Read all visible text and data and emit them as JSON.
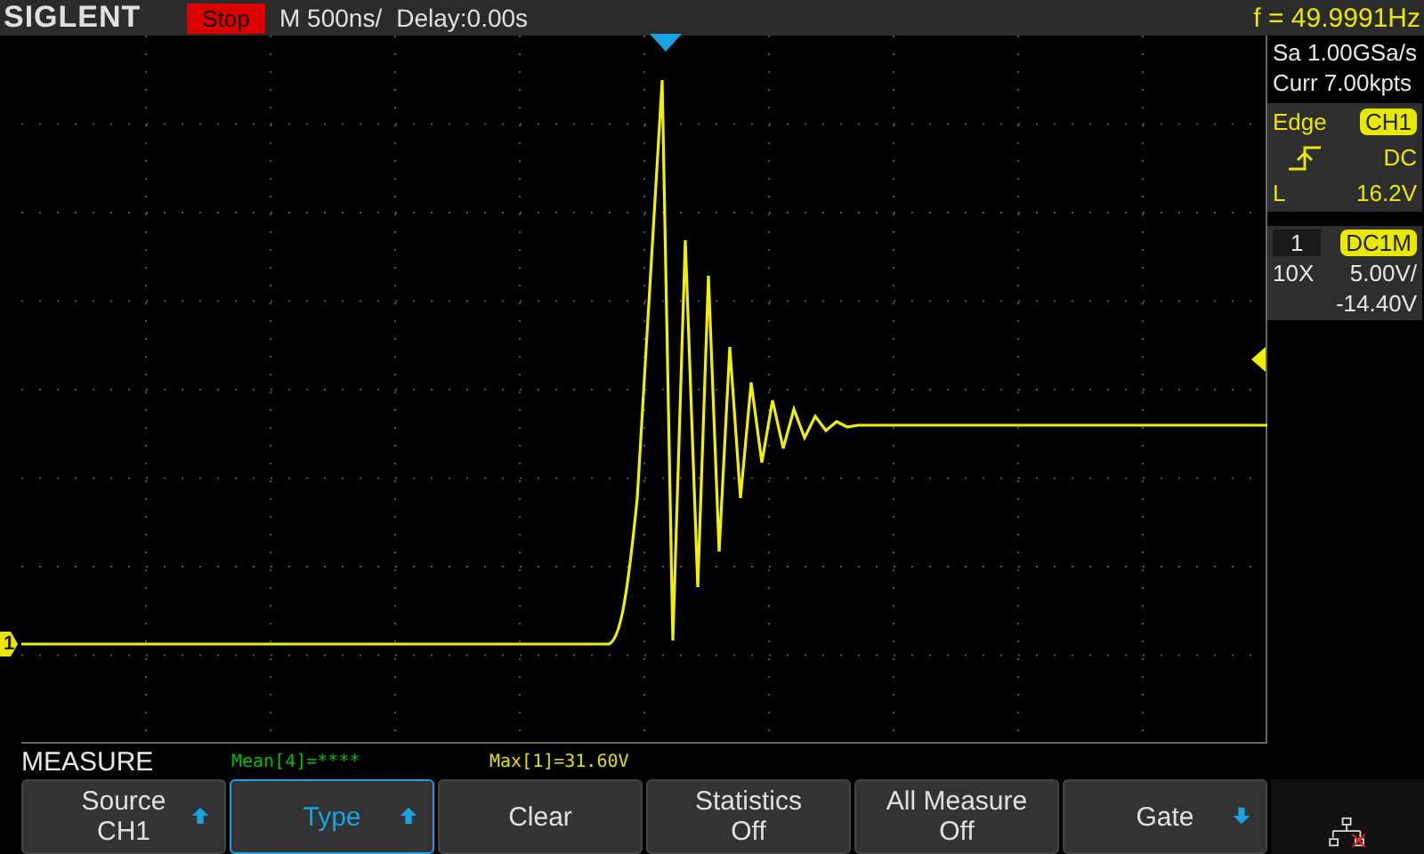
{
  "header": {
    "brand": "SIGLENT",
    "run_state": "Stop",
    "timebase": "M 500ns/",
    "delay": "Delay:0.00s",
    "frequency": "f = 49.9991Hz"
  },
  "acquisition": {
    "sample_rate": "Sa 1.00GSa/s",
    "memory": "Curr 7.00kpts"
  },
  "trigger": {
    "type": "Edge",
    "source": "CH1",
    "coupling": "DC",
    "level_label": "L",
    "level_value": "16.2V"
  },
  "channel": {
    "number": "1",
    "coupling": "DC1M",
    "probe": "10X",
    "scale": "5.00V/",
    "offset": "-14.40V"
  },
  "channel_marker": "1",
  "measure": {
    "title": "MEASURE",
    "readings": [
      {
        "text": "Mean[4]=****",
        "color": "#00c000"
      },
      {
        "text": "Max[1]=31.60V",
        "color": "#e0e000"
      }
    ]
  },
  "softkeys": [
    {
      "kind": "up",
      "label": "Source",
      "value": "CH1",
      "selected": false
    },
    {
      "kind": "up",
      "label": "Type",
      "selected": true
    },
    {
      "kind": "plain",
      "label": "Clear",
      "selected": false
    },
    {
      "kind": "plain",
      "label": "Statistics",
      "value": "Off",
      "selected": false
    },
    {
      "kind": "plain",
      "label": "All Measure",
      "value": "Off",
      "selected": false
    },
    {
      "kind": "down",
      "label": "Gate",
      "selected": false
    }
  ]
}
